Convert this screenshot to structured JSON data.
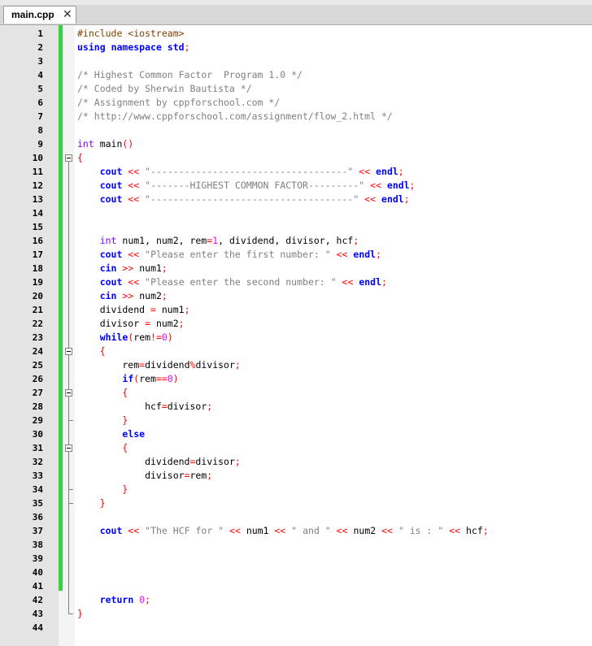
{
  "tab": {
    "title": "main.cpp",
    "close_symbol": "✕"
  },
  "lines": [
    {
      "n": "1",
      "code": "#include <iostream>"
    },
    {
      "n": "2",
      "code": "using namespace std;"
    },
    {
      "n": "3",
      "code": ""
    },
    {
      "n": "4",
      "code": "/* Highest Common Factor  Program 1.0 */"
    },
    {
      "n": "5",
      "code": "/* Coded by Sherwin Bautista */"
    },
    {
      "n": "6",
      "code": "/* Assignment by cppforschool.com */"
    },
    {
      "n": "7",
      "code": "/* http://www.cppforschool.com/assignment/flow_2.html */"
    },
    {
      "n": "8",
      "code": ""
    },
    {
      "n": "9",
      "code": "int main()"
    },
    {
      "n": "10",
      "code": "{"
    },
    {
      "n": "11",
      "code": "    cout << \"-----------------------------------\" << endl;"
    },
    {
      "n": "12",
      "code": "    cout << \"-------HIGHEST COMMON FACTOR---------\" << endl;"
    },
    {
      "n": "13",
      "code": "    cout << \"------------------------------------\" << endl;"
    },
    {
      "n": "14",
      "code": ""
    },
    {
      "n": "15",
      "code": ""
    },
    {
      "n": "16",
      "code": "    int num1, num2, rem=1, dividend, divisor, hcf;"
    },
    {
      "n": "17",
      "code": "    cout << \"Please enter the first number: \" << endl;"
    },
    {
      "n": "18",
      "code": "    cin >> num1;"
    },
    {
      "n": "19",
      "code": "    cout << \"Please enter the second number: \" << endl;"
    },
    {
      "n": "20",
      "code": "    cin >> num2;"
    },
    {
      "n": "21",
      "code": "    dividend = num1;"
    },
    {
      "n": "22",
      "code": "    divisor = num2;"
    },
    {
      "n": "23",
      "code": "    while(rem!=0)"
    },
    {
      "n": "24",
      "code": "    {"
    },
    {
      "n": "25",
      "code": "        rem=dividend%divisor;"
    },
    {
      "n": "26",
      "code": "        if(rem==0)"
    },
    {
      "n": "27",
      "code": "        {"
    },
    {
      "n": "28",
      "code": "            hcf=divisor;"
    },
    {
      "n": "29",
      "code": "        }"
    },
    {
      "n": "30",
      "code": "        else"
    },
    {
      "n": "31",
      "code": "        {"
    },
    {
      "n": "32",
      "code": "            dividend=divisor;"
    },
    {
      "n": "33",
      "code": "            divisor=rem;"
    },
    {
      "n": "34",
      "code": "        }"
    },
    {
      "n": "35",
      "code": "    }"
    },
    {
      "n": "36",
      "code": ""
    },
    {
      "n": "37",
      "code": "    cout << \"The HCF for \" << num1 << \" and \" << num2 << \" is : \" << hcf;"
    },
    {
      "n": "38",
      "code": ""
    },
    {
      "n": "39",
      "code": ""
    },
    {
      "n": "40",
      "code": ""
    },
    {
      "n": "41",
      "code": ""
    },
    {
      "n": "42",
      "code": "    return 0;"
    },
    {
      "n": "43",
      "code": "}"
    },
    {
      "n": "44",
      "code": ""
    }
  ],
  "colors": {
    "keyword": "#0000ff",
    "preprocessor": "#804000",
    "comment": "#808080",
    "string": "#808080",
    "type": "#8000ff",
    "operator": "#ff0000",
    "number": "#ff00ff",
    "change_marker": "#39d13d"
  }
}
